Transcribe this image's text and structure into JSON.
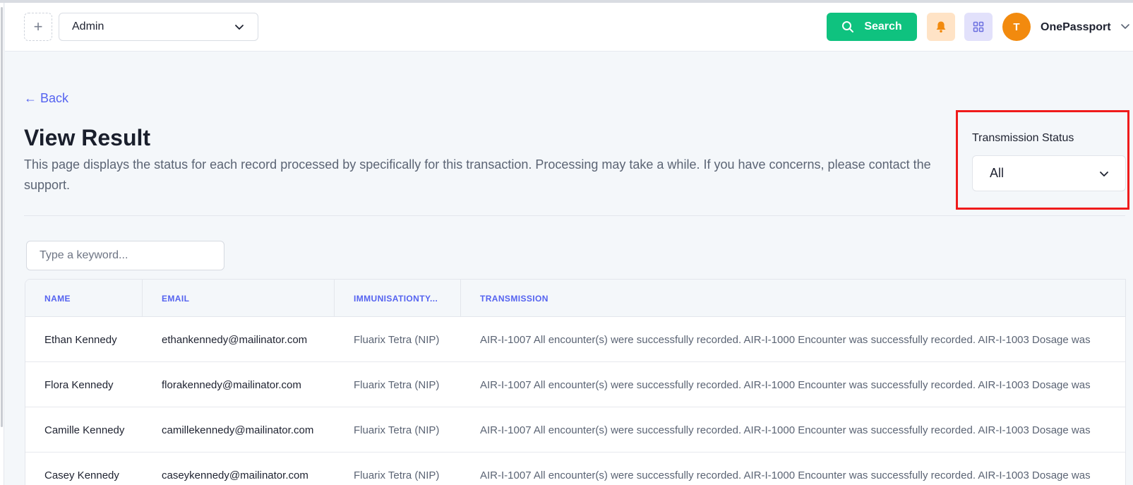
{
  "header": {
    "add_label": "+",
    "role_select": "Admin",
    "search_label": "Search",
    "avatar_initial": "T",
    "account_name": "OnePassport"
  },
  "page": {
    "back_label": "← Back",
    "title": "View Result",
    "description": "This page displays the status for each record processed by specifically for this transaction. Processing may take a while. If you have concerns, please contact the support."
  },
  "filter": {
    "label": "Transmission Status",
    "value": "All"
  },
  "search": {
    "placeholder": "Type a keyword..."
  },
  "table": {
    "columns": [
      "NAME",
      "EMAIL",
      "IMMUNISATIONTY...",
      "TRANSMISSION"
    ],
    "rows": [
      {
        "name": "Ethan Kennedy",
        "email": "ethankennedy@mailinator.com",
        "type": "Fluarix Tetra (NIP)",
        "transmission": "AIR-I-1007 All encounter(s) were successfully recorded. AIR-I-1000 Encounter was successfully recorded. AIR-I-1003 Dosage was"
      },
      {
        "name": "Flora Kennedy",
        "email": "florakennedy@mailinator.com",
        "type": "Fluarix Tetra (NIP)",
        "transmission": "AIR-I-1007 All encounter(s) were successfully recorded. AIR-I-1000 Encounter was successfully recorded. AIR-I-1003 Dosage was"
      },
      {
        "name": "Camille Kennedy",
        "email": "camillekennedy@mailinator.com",
        "type": "Fluarix Tetra (NIP)",
        "transmission": "AIR-I-1007 All encounter(s) were successfully recorded. AIR-I-1000 Encounter was successfully recorded. AIR-I-1003 Dosage was"
      },
      {
        "name": "Casey Kennedy",
        "email": "caseykennedy@mailinator.com",
        "type": "Fluarix Tetra (NIP)",
        "transmission": "AIR-I-1007 All encounter(s) were successfully recorded. AIR-I-1000 Encounter was successfully recorded. AIR-I-1003 Dosage was"
      }
    ]
  },
  "icons": {
    "add": "plus-icon",
    "role_chevron": "chevron-down-icon",
    "search": "search-icon",
    "bell": "bell-icon",
    "apps": "grid-icon",
    "back": "arrow-left-icon"
  },
  "colors": {
    "primary_green": "#0fc27f",
    "accent_indigo": "#5563f0",
    "avatar_orange": "#f28a0e",
    "highlight_red": "#ef1b1b"
  }
}
